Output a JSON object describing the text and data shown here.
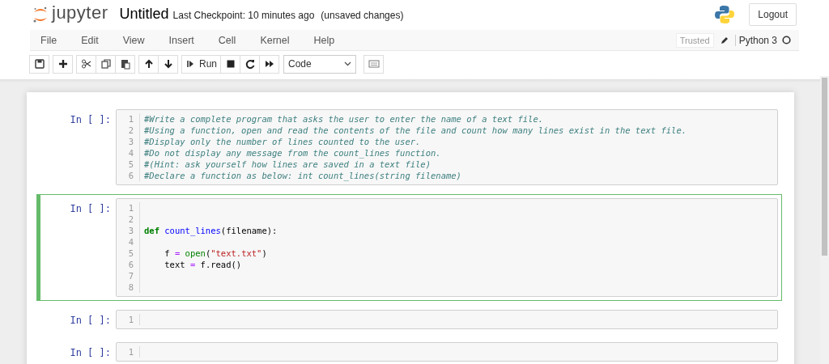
{
  "header": {
    "logo_text": "jupyter",
    "notebook_name": "Untitled",
    "checkpoint": "Last Checkpoint: 10 minutes ago",
    "save_status": "(unsaved changes)",
    "logout": "Logout"
  },
  "menu": [
    "File",
    "Edit",
    "View",
    "Insert",
    "Cell",
    "Kernel",
    "Help"
  ],
  "kernel": {
    "trusted": "Trusted",
    "name": "Python 3",
    "busy": false
  },
  "toolbar": [
    {
      "group": [
        {
          "kind": "save"
        }
      ]
    },
    {
      "group": [
        {
          "kind": "add"
        }
      ]
    },
    {
      "group": [
        {
          "kind": "cut"
        },
        {
          "kind": "copy"
        },
        {
          "kind": "paste"
        }
      ]
    },
    {
      "group": [
        {
          "kind": "up"
        },
        {
          "kind": "down"
        }
      ]
    },
    {
      "group": [
        {
          "kind": "run",
          "label": "Run"
        },
        {
          "kind": "stop"
        },
        {
          "kind": "restart"
        },
        {
          "kind": "fast-forward"
        }
      ]
    }
  ],
  "cell_type": "Code",
  "cells": [
    {
      "prompt": "In [ ]:",
      "selected": false,
      "lines": [
        {
          "number": "1",
          "tokens": [
            {
              "kind": "comment",
              "text": "#Write a complete program that asks the user to enter the name of a text file."
            }
          ]
        },
        {
          "number": "2",
          "tokens": [
            {
              "kind": "comment",
              "text": "#Using a function, open and read the contents of the file and count how many lines exist in the text file."
            }
          ]
        },
        {
          "number": "3",
          "tokens": [
            {
              "kind": "comment",
              "text": "#Display only the number of lines counted to the user."
            }
          ]
        },
        {
          "number": "4",
          "tokens": [
            {
              "kind": "comment",
              "text": "#Do not display any message from the count_lines function."
            }
          ]
        },
        {
          "number": "5",
          "tokens": [
            {
              "kind": "comment",
              "text": "#(Hint: ask yourself how lines are saved in a text file)"
            }
          ]
        },
        {
          "number": "6",
          "tokens": [
            {
              "kind": "comment",
              "text": "#Declare a function as below: int count_lines(string filename)"
            }
          ]
        }
      ]
    },
    {
      "prompt": "In [ ]:",
      "selected": true,
      "lines": [
        {
          "number": "1"
        },
        {
          "number": "2"
        },
        {
          "number": "3",
          "tokens": [
            {
              "kind": "keyword",
              "text": "def "
            },
            {
              "kind": "def",
              "text": "count_lines"
            },
            {
              "kind": "plain",
              "text": "(filename):"
            }
          ]
        },
        {
          "number": "4"
        },
        {
          "number": "5",
          "tokens": [
            {
              "kind": "plain",
              "text": "    f "
            },
            {
              "kind": "operator",
              "text": "= "
            },
            {
              "kind": "builtin",
              "text": "open"
            },
            {
              "kind": "plain",
              "text": "("
            },
            {
              "kind": "string",
              "text": "\"text.txt\""
            },
            {
              "kind": "plain",
              "text": ")"
            }
          ]
        },
        {
          "number": "6",
          "tokens": [
            {
              "kind": "plain",
              "text": "    text "
            },
            {
              "kind": "operator",
              "text": "= "
            },
            {
              "kind": "plain",
              "text": "f.read()"
            }
          ]
        },
        {
          "number": "7"
        },
        {
          "number": "8"
        }
      ]
    },
    {
      "prompt": "In [ ]:",
      "selected": false,
      "lines": [
        {
          "number": "1"
        }
      ]
    },
    {
      "prompt": "In [ ]:",
      "selected": false,
      "lines": [
        {
          "number": "1"
        }
      ]
    }
  ]
}
